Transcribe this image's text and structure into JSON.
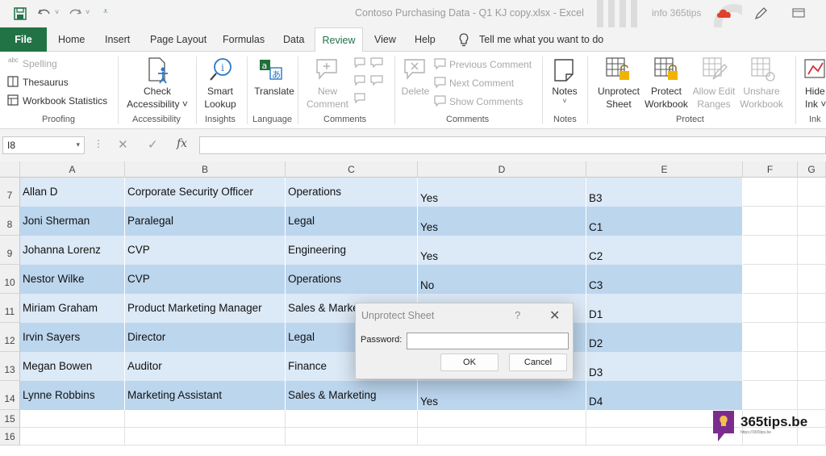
{
  "app": {
    "document_title": "Contoso Purchasing Data - Q1 KJ copy.xlsx - Excel",
    "user_text": "info 365tips"
  },
  "tabs": [
    "File",
    "Home",
    "Insert",
    "Page Layout",
    "Formulas",
    "Data",
    "Review",
    "View",
    "Help"
  ],
  "active_tab": "Review",
  "tell_me": "Tell me what you want to do",
  "ribbon": {
    "proofing": {
      "spelling": "Spelling",
      "thesaurus": "Thesaurus",
      "workbook_statistics": "Workbook Statistics",
      "label": "Proofing"
    },
    "accessibility": {
      "check_line1": "Check",
      "check_line2": "Accessibility ˅",
      "label": "Accessibility"
    },
    "insights": {
      "smart_line1": "Smart",
      "smart_line2": "Lookup",
      "label": "Insights"
    },
    "language": {
      "translate": "Translate",
      "label": "Language"
    },
    "comments": {
      "new_line1": "New",
      "new_line2": "Comment",
      "label": "Comments"
    },
    "comments2": {
      "delete": "Delete",
      "previous": "Previous Comment",
      "next": "Next Comment",
      "show": "Show Comments",
      "label": "Comments"
    },
    "notes": {
      "notes": "Notes",
      "label": "Notes"
    },
    "protect": {
      "unprotect_line1": "Unprotect",
      "unprotect_line2": "Sheet",
      "protect_line1": "Protect",
      "protect_line2": "Workbook",
      "allow_line1": "Allow Edit",
      "allow_line2": "Ranges",
      "unshare_line1": "Unshare",
      "unshare_line2": "Workbook",
      "label": "Protect"
    },
    "ink": {
      "hide_line1": "Hide",
      "hide_line2": "Ink ˅",
      "label": "Ink"
    }
  },
  "formula_bar": {
    "name_box": "I8",
    "fx": "fx",
    "value": ""
  },
  "columns": [
    "A",
    "B",
    "C",
    "D",
    "E",
    "F",
    "G"
  ],
  "rows": [
    {
      "num": "7",
      "a": "Allan D",
      "b": "Corporate Security Officer",
      "c": "Operations",
      "d": "Yes",
      "e": "B3"
    },
    {
      "num": "8",
      "a": "Joni Sherman",
      "b": "Paralegal",
      "c": "Legal",
      "d": "Yes",
      "e": "C1"
    },
    {
      "num": "9",
      "a": "Johanna Lorenz",
      "b": "CVP",
      "c": "Engineering",
      "d": "Yes",
      "e": "C2"
    },
    {
      "num": "10",
      "a": "Nestor Wilke",
      "b": "CVP",
      "c": "Operations",
      "d": "No",
      "e": "C3"
    },
    {
      "num": "11",
      "a": "Miriam Graham",
      "b": "Product Marketing Manager",
      "c": "Sales & Marketing",
      "d": "",
      "e": "D1"
    },
    {
      "num": "12",
      "a": "Irvin Sayers",
      "b": "Director",
      "c": "Legal",
      "d": "",
      "e": "D2"
    },
    {
      "num": "13",
      "a": "Megan Bowen",
      "b": "Auditor",
      "c": "Finance",
      "d": "",
      "e": "D3"
    },
    {
      "num": "14",
      "a": "Lynne Robbins",
      "b": "Marketing Assistant",
      "c": "Sales & Marketing",
      "d": "Yes",
      "e": "D4"
    }
  ],
  "empty_rows": [
    "15",
    "16"
  ],
  "dialog": {
    "title": "Unprotect Sheet",
    "help": "?",
    "close": "✕",
    "password_label": "Password:",
    "password_value": "",
    "ok": "OK",
    "cancel": "Cancel"
  },
  "logo": {
    "text": "365tips.be",
    "small": "https://365tips.be",
    "color": "#7b2d8e"
  },
  "colors": {
    "excel_green": "#217346",
    "band_light": "#dce9f6",
    "band_dark": "#bcd6ee",
    "office_red": "#e0412b"
  }
}
